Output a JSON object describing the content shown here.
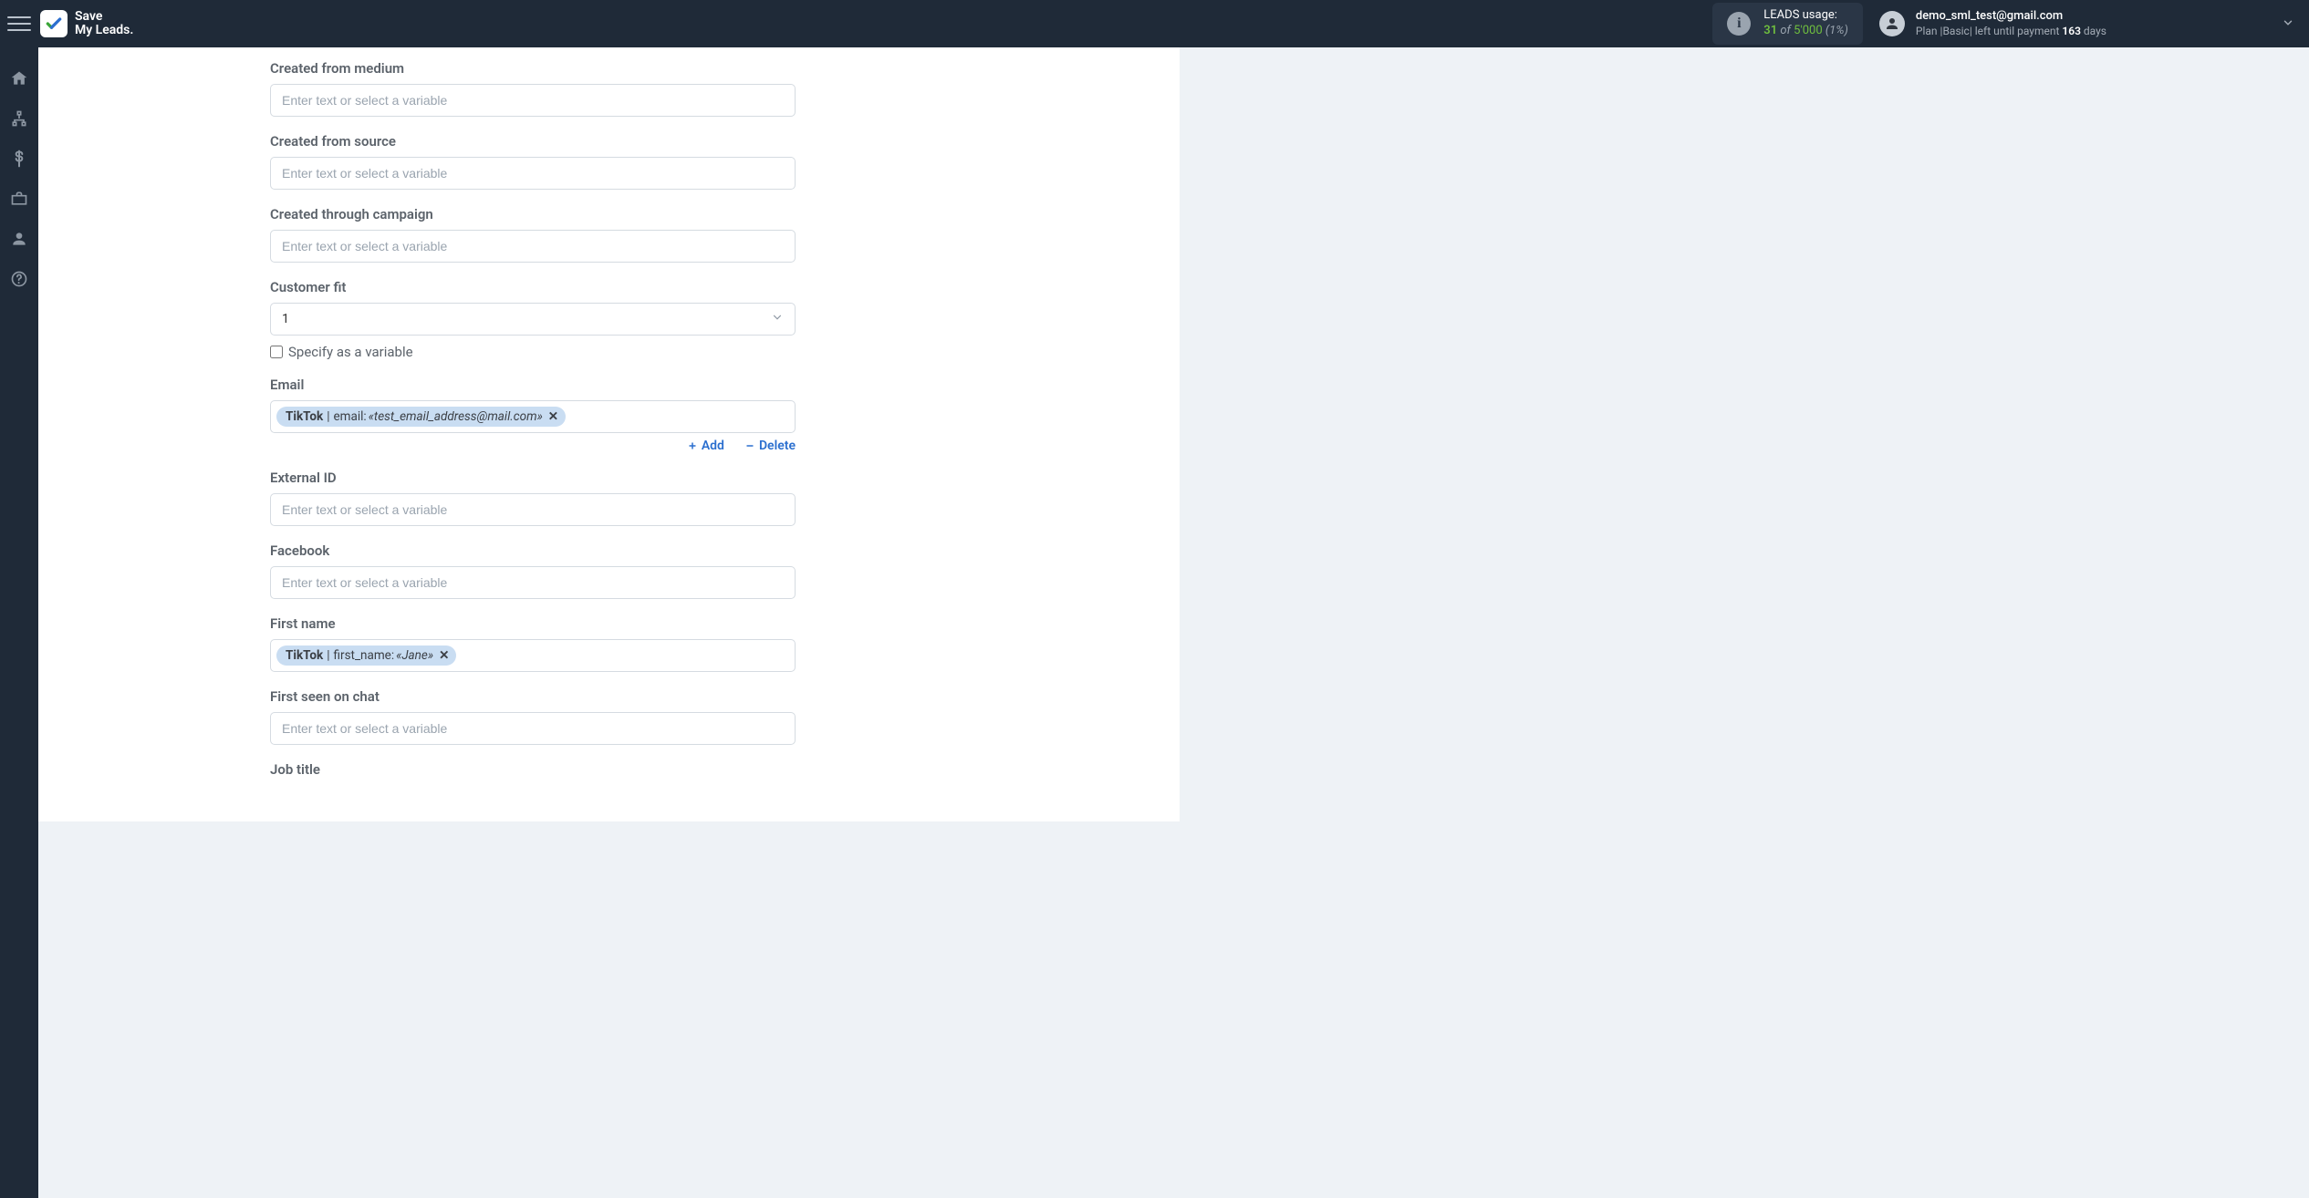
{
  "brand": {
    "line1": "Save",
    "line2": "My Leads."
  },
  "usage": {
    "label": "LEADS usage:",
    "current": "31",
    "of_word": "of",
    "max": "5'000",
    "pct": "(1%)"
  },
  "account": {
    "email": "demo_sml_test@gmail.com",
    "plan_prefix": "Plan |",
    "plan_name": "Basic",
    "plan_mid": "| left until payment ",
    "days_num": "163",
    "days_word": " days"
  },
  "sidebar": {
    "items": [
      "home",
      "hierarchy",
      "billing",
      "briefcase",
      "profile",
      "help"
    ]
  },
  "form": {
    "placeholder": "Enter text or select a variable",
    "specify_variable": "Specify as a variable",
    "add_label": "Add",
    "delete_label": "Delete",
    "fields": {
      "created_from_medium": {
        "label": "Created from medium"
      },
      "created_from_source": {
        "label": "Created from source"
      },
      "created_through_campaign": {
        "label": "Created through campaign"
      },
      "customer_fit": {
        "label": "Customer fit",
        "value": "1"
      },
      "email": {
        "label": "Email",
        "chip": {
          "source": "TikTok",
          "key": "email:",
          "value": "«test_email_address@mail.com»"
        }
      },
      "external_id": {
        "label": "External ID"
      },
      "facebook": {
        "label": "Facebook"
      },
      "first_name": {
        "label": "First name",
        "chip": {
          "source": "TikTok",
          "key": "first_name:",
          "value": "«Jane»"
        }
      },
      "first_seen_on_chat": {
        "label": "First seen on chat"
      },
      "job_title": {
        "label": "Job title"
      }
    }
  }
}
